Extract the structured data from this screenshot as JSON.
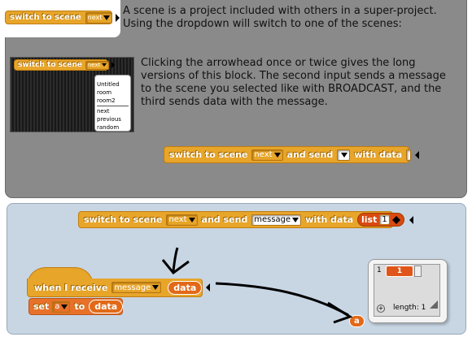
{
  "top_panel": {
    "main_block": {
      "label": "switch to scene",
      "dropdown_value": "next"
    },
    "description_1": "A scene is a project included with others in a super-project. Using the dropdown will switch to one of the scenes:",
    "stage_block": {
      "label": "switch to scene",
      "dropdown_value": "next"
    },
    "scene_menu": {
      "items": [
        "Untitled",
        "room",
        "room2"
      ],
      "extra_items": [
        "next",
        "previous",
        "random"
      ]
    },
    "description_2": "Clicking the arrowhead once or twice gives the long versions of this block. The second input sends a message to the scene you selected like with BROADCAST, and the third sends data with the message.",
    "long_block": {
      "label": "switch to scene",
      "dropdown_value": "next",
      "and_send": "and send",
      "with_data": "with data"
    }
  },
  "bottom_panel": {
    "long_block": {
      "label": "switch to scene",
      "dropdown_value": "next",
      "and_send": "and send",
      "message_value": "message",
      "with_data": "with data",
      "list_label": "list",
      "list_value": "1"
    },
    "hat_block": {
      "label": "when I receive",
      "dropdown_value": "message",
      "param": "data"
    },
    "set_block": {
      "label": "set",
      "var": "a",
      "to": "to",
      "value": "data"
    },
    "result_bubble": {
      "index": "1",
      "value": "1",
      "length_label": "length: 1",
      "var_label": "a"
    }
  },
  "colors": {
    "control": "#e7a52a",
    "variable": "#e26918",
    "panel_top": "#8a8a8a",
    "panel_bottom": "#c8d6e4"
  }
}
